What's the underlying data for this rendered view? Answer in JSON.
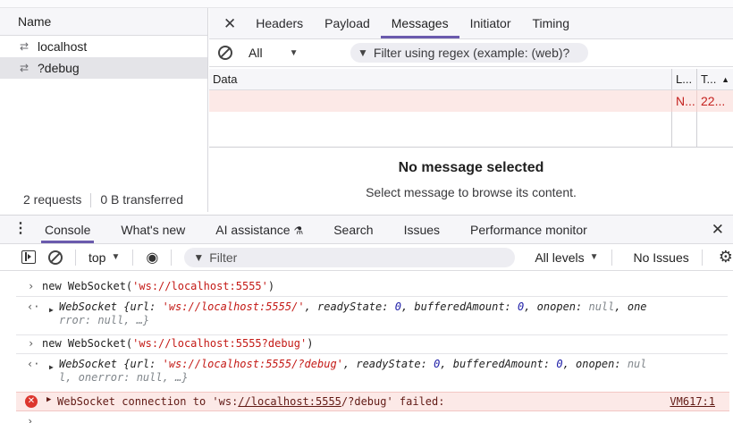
{
  "network": {
    "name_header": "Name",
    "requests": [
      {
        "name": "localhost",
        "icon": "websocket-arrows-icon",
        "selected": false
      },
      {
        "name": "?debug",
        "icon": "websocket-arrows-icon",
        "selected": true
      }
    ],
    "footer": {
      "requests": "2 requests",
      "transferred": "0 B transferred"
    },
    "tabs": [
      "Headers",
      "Payload",
      "Messages",
      "Initiator",
      "Timing"
    ],
    "active_tab": "Messages",
    "filter": {
      "type_select": "All",
      "regex_placeholder": "Filter using regex (example: (web)?"
    },
    "table": {
      "columns": {
        "data": "Data",
        "length": "L...",
        "time": "T..."
      },
      "rows": [
        {
          "data": "",
          "length": "N...",
          "time": "22..."
        }
      ]
    },
    "empty_state": {
      "title": "No message selected",
      "subtitle": "Select message to browse its content."
    }
  },
  "drawer": {
    "tabs": [
      "Console",
      "What's new",
      "AI assistance",
      "Search",
      "Issues",
      "Performance monitor"
    ],
    "active_tab": "Console",
    "ai_flask_glyph": "⚗"
  },
  "console_toolbar": {
    "context": "top",
    "filter_placeholder": "Filter",
    "levels": "All levels",
    "issues": "No Issues"
  },
  "console": {
    "cmd1": "new WebSocket(",
    "cmd1_arg": "'ws://localhost:5555'",
    "cmd1_close": ")",
    "res1_line1_parts": {
      "type": "WebSocket",
      "url_key": "url: ",
      "url": "'ws://localhost:5555/'",
      "ready_key": ", readyState: ",
      "ready": "0",
      "buf_key": ", bufferedAmount: ",
      "buf": "0",
      "open_key": ", onopen: ",
      "open": "null",
      "tail": ", one"
    },
    "res1_line2": "rror: null, …}",
    "cmd2": "new WebSocket(",
    "cmd2_arg": "'ws://localhost:5555?debug'",
    "cmd2_close": ")",
    "res2_line1_parts": {
      "type": "WebSocket",
      "url_key": "url: ",
      "url": "'ws://localhost:5555/?debug'",
      "ready_key": ", readyState: ",
      "ready": "0",
      "buf_key": ", bufferedAmount: ",
      "buf": "0",
      "open_key": ", onopen: ",
      "open": "nul"
    },
    "res2_line2": "l, onerror: null, …}",
    "error": {
      "prefix": "WebSocket connection to 'ws:",
      "link": "//localhost:5555",
      "suffix": "/?debug' failed:",
      "source": "VM617:1"
    }
  },
  "colors": {
    "accent": "#6a5aad",
    "error_bg": "#fce9e7",
    "error_icon": "#dc362e",
    "string": "#c41a16",
    "number": "#1a1aa6"
  }
}
